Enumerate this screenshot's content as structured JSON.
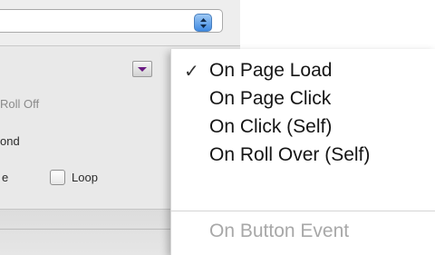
{
  "panel": {
    "roll_off_label": "Roll Off",
    "ond_label": "ond",
    "e_label": "e",
    "loop_label": "Loop"
  },
  "menu": {
    "items": [
      {
        "label": "On Page Load",
        "checked": true,
        "enabled": true
      },
      {
        "label": "On Page Click",
        "checked": false,
        "enabled": true
      },
      {
        "label": "On Click (Self)",
        "checked": false,
        "enabled": true
      },
      {
        "label": "On Roll Over (Self)",
        "checked": false,
        "enabled": true
      },
      {
        "label": "On Button Event",
        "checked": false,
        "enabled": false
      }
    ],
    "check_glyph": "✓"
  },
  "icons": {
    "stepper": "up-down-stepper-icon",
    "dropdown": "dropdown-arrow-icon"
  },
  "colors": {
    "stepper_blue": "#3f8ae3",
    "dropdown_arrow": "#6a1a82"
  }
}
